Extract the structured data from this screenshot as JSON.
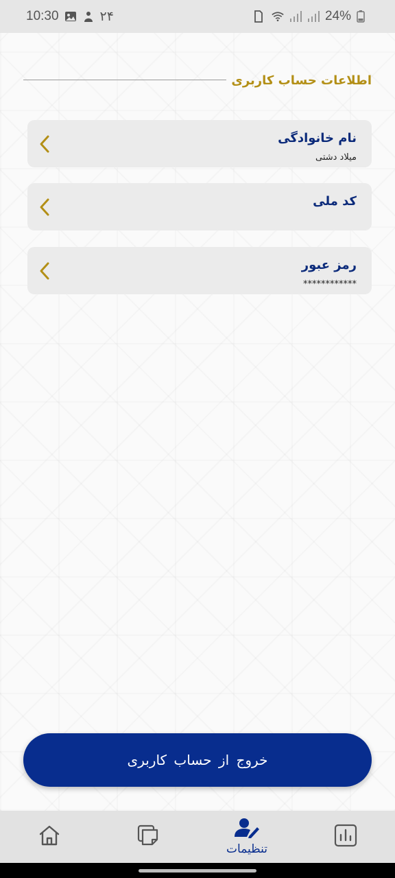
{
  "status_bar": {
    "time": "10:30",
    "notification_badge": "۲۴",
    "battery": "24%"
  },
  "section": {
    "title": "اطلاعات حساب کاربری"
  },
  "cards": [
    {
      "label": "نام خانوادگی",
      "value": "میلاد دشتی"
    },
    {
      "label": "کد ملی",
      "value": ""
    },
    {
      "label": "رمز عبور",
      "value": "************"
    }
  ],
  "logout_label": "خروج از حساب کاربری",
  "bottom_nav": {
    "items": [
      {
        "icon": "chart-icon",
        "label": ""
      },
      {
        "icon": "user-edit-icon",
        "label": "تنظیمات"
      },
      {
        "icon": "note-icon",
        "label": ""
      },
      {
        "icon": "home-icon",
        "label": ""
      }
    ]
  },
  "colors": {
    "primary": "#082d8e",
    "accent": "#b38f16",
    "card_bg": "#ebebeb"
  }
}
